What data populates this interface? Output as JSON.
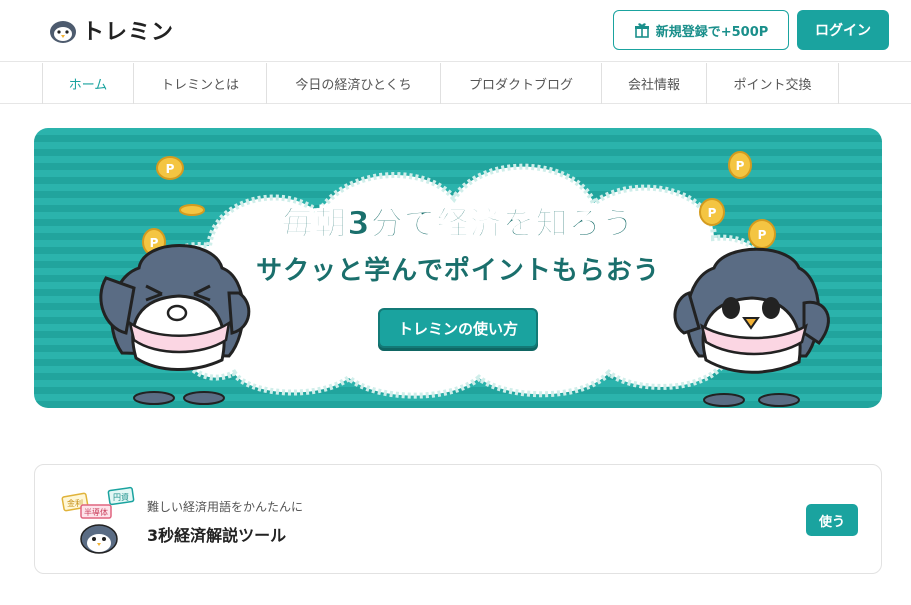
{
  "header": {
    "logo_text": "トレミン",
    "register_label": "新規登録で+500P",
    "login_label": "ログイン"
  },
  "nav": {
    "items": [
      {
        "label": "ホーム",
        "active": true
      },
      {
        "label": "トレミンとは"
      },
      {
        "label": "今日の経済ひとくち"
      },
      {
        "label": "プロダクトブログ"
      },
      {
        "label": "会社情報"
      },
      {
        "label": "ポイント交換"
      }
    ]
  },
  "hero": {
    "title1": "毎朝3分で経済を知ろう",
    "title2": "サクッと学んでポイントもらおう",
    "button_label": "トレミンの使い方",
    "coin_letter": "P"
  },
  "tool_card": {
    "subtitle": "難しい経済用語をかんたんに",
    "title": "3秒経済解説ツール",
    "button_label": "使う",
    "tags": [
      "金利",
      "円資",
      "半導体"
    ]
  },
  "colors": {
    "accent": "#1aa39f",
    "hero_stripe_a": "#2bb3ac",
    "hero_stripe_b": "#21a49d"
  }
}
